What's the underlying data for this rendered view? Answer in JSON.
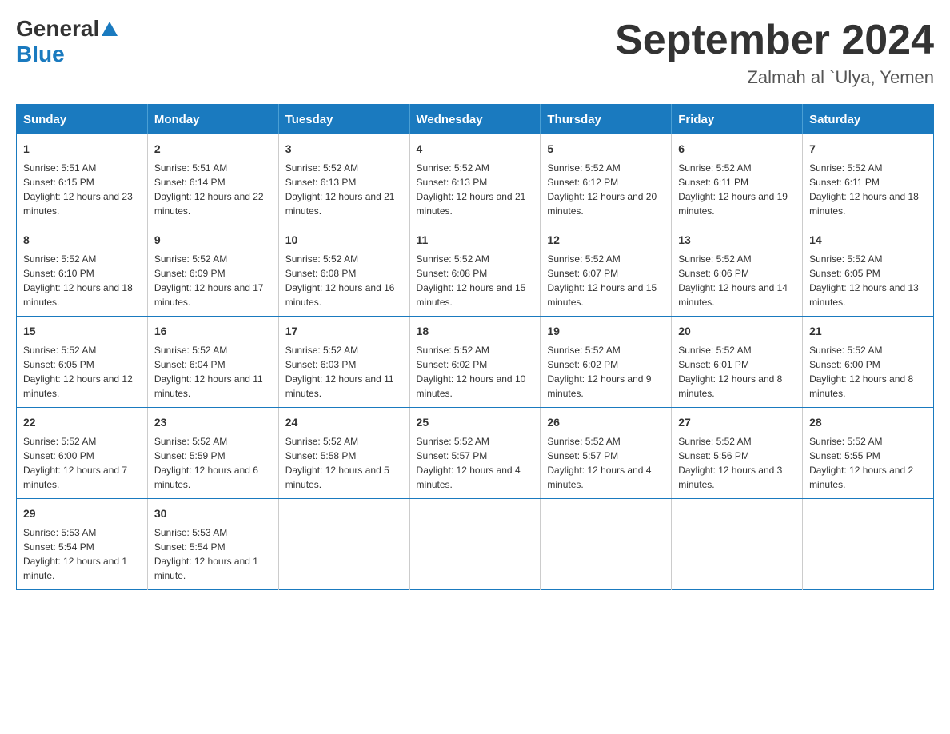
{
  "header": {
    "logo_general": "General",
    "logo_blue": "Blue",
    "month_title": "September 2024",
    "location": "Zalmah al `Ulya, Yemen"
  },
  "weekdays": [
    "Sunday",
    "Monday",
    "Tuesday",
    "Wednesday",
    "Thursday",
    "Friday",
    "Saturday"
  ],
  "weeks": [
    [
      {
        "day": "1",
        "sunrise": "5:51 AM",
        "sunset": "6:15 PM",
        "daylight": "12 hours and 23 minutes."
      },
      {
        "day": "2",
        "sunrise": "5:51 AM",
        "sunset": "6:14 PM",
        "daylight": "12 hours and 22 minutes."
      },
      {
        "day": "3",
        "sunrise": "5:52 AM",
        "sunset": "6:13 PM",
        "daylight": "12 hours and 21 minutes."
      },
      {
        "day": "4",
        "sunrise": "5:52 AM",
        "sunset": "6:13 PM",
        "daylight": "12 hours and 21 minutes."
      },
      {
        "day": "5",
        "sunrise": "5:52 AM",
        "sunset": "6:12 PM",
        "daylight": "12 hours and 20 minutes."
      },
      {
        "day": "6",
        "sunrise": "5:52 AM",
        "sunset": "6:11 PM",
        "daylight": "12 hours and 19 minutes."
      },
      {
        "day": "7",
        "sunrise": "5:52 AM",
        "sunset": "6:11 PM",
        "daylight": "12 hours and 18 minutes."
      }
    ],
    [
      {
        "day": "8",
        "sunrise": "5:52 AM",
        "sunset": "6:10 PM",
        "daylight": "12 hours and 18 minutes."
      },
      {
        "day": "9",
        "sunrise": "5:52 AM",
        "sunset": "6:09 PM",
        "daylight": "12 hours and 17 minutes."
      },
      {
        "day": "10",
        "sunrise": "5:52 AM",
        "sunset": "6:08 PM",
        "daylight": "12 hours and 16 minutes."
      },
      {
        "day": "11",
        "sunrise": "5:52 AM",
        "sunset": "6:08 PM",
        "daylight": "12 hours and 15 minutes."
      },
      {
        "day": "12",
        "sunrise": "5:52 AM",
        "sunset": "6:07 PM",
        "daylight": "12 hours and 15 minutes."
      },
      {
        "day": "13",
        "sunrise": "5:52 AM",
        "sunset": "6:06 PM",
        "daylight": "12 hours and 14 minutes."
      },
      {
        "day": "14",
        "sunrise": "5:52 AM",
        "sunset": "6:05 PM",
        "daylight": "12 hours and 13 minutes."
      }
    ],
    [
      {
        "day": "15",
        "sunrise": "5:52 AM",
        "sunset": "6:05 PM",
        "daylight": "12 hours and 12 minutes."
      },
      {
        "day": "16",
        "sunrise": "5:52 AM",
        "sunset": "6:04 PM",
        "daylight": "12 hours and 11 minutes."
      },
      {
        "day": "17",
        "sunrise": "5:52 AM",
        "sunset": "6:03 PM",
        "daylight": "12 hours and 11 minutes."
      },
      {
        "day": "18",
        "sunrise": "5:52 AM",
        "sunset": "6:02 PM",
        "daylight": "12 hours and 10 minutes."
      },
      {
        "day": "19",
        "sunrise": "5:52 AM",
        "sunset": "6:02 PM",
        "daylight": "12 hours and 9 minutes."
      },
      {
        "day": "20",
        "sunrise": "5:52 AM",
        "sunset": "6:01 PM",
        "daylight": "12 hours and 8 minutes."
      },
      {
        "day": "21",
        "sunrise": "5:52 AM",
        "sunset": "6:00 PM",
        "daylight": "12 hours and 8 minutes."
      }
    ],
    [
      {
        "day": "22",
        "sunrise": "5:52 AM",
        "sunset": "6:00 PM",
        "daylight": "12 hours and 7 minutes."
      },
      {
        "day": "23",
        "sunrise": "5:52 AM",
        "sunset": "5:59 PM",
        "daylight": "12 hours and 6 minutes."
      },
      {
        "day": "24",
        "sunrise": "5:52 AM",
        "sunset": "5:58 PM",
        "daylight": "12 hours and 5 minutes."
      },
      {
        "day": "25",
        "sunrise": "5:52 AM",
        "sunset": "5:57 PM",
        "daylight": "12 hours and 4 minutes."
      },
      {
        "day": "26",
        "sunrise": "5:52 AM",
        "sunset": "5:57 PM",
        "daylight": "12 hours and 4 minutes."
      },
      {
        "day": "27",
        "sunrise": "5:52 AM",
        "sunset": "5:56 PM",
        "daylight": "12 hours and 3 minutes."
      },
      {
        "day": "28",
        "sunrise": "5:52 AM",
        "sunset": "5:55 PM",
        "daylight": "12 hours and 2 minutes."
      }
    ],
    [
      {
        "day": "29",
        "sunrise": "5:53 AM",
        "sunset": "5:54 PM",
        "daylight": "12 hours and 1 minute."
      },
      {
        "day": "30",
        "sunrise": "5:53 AM",
        "sunset": "5:54 PM",
        "daylight": "12 hours and 1 minute."
      },
      null,
      null,
      null,
      null,
      null
    ]
  ],
  "labels": {
    "sunrise": "Sunrise:",
    "sunset": "Sunset:",
    "daylight": "Daylight:"
  }
}
